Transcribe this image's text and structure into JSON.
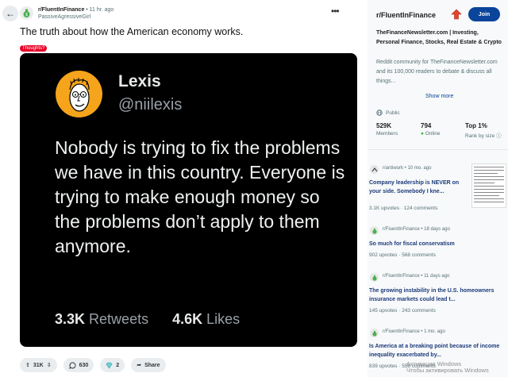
{
  "post": {
    "subreddit": "r/FluentInFinance",
    "time": " • 11 hr. ago",
    "author": "PassiveAgressiveGirl",
    "title": "The truth about how the American economy works.",
    "flair": "Thoughts?",
    "more_icon": "ellipsis-icon"
  },
  "tweet": {
    "name": "Lexis",
    "handle": "@niilexis",
    "text": "Nobody is trying to fix the problems we have in this country. Everyone is trying to make enough money so the problems don’t apply to them anymore.",
    "retweets_count": "3.3K",
    "retweets_label": "Retweets",
    "likes_count": "4.6K",
    "likes_label": "Likes"
  },
  "actions": {
    "votes": "31K",
    "comments": "630",
    "awards": "2",
    "share": "Share"
  },
  "sidebar": {
    "name": "r/FluentInFinance",
    "join": "Join",
    "headline": "TheFinanceNewsletter.com | Investing, Personal Finance, Stocks, Real Estate & Crypto",
    "description": "Reddit community for TheFinanceNewsletter.com and its 100,000 readers to debate & discuss all things...",
    "show_more": "Show more",
    "visibility": "Public",
    "stats": [
      {
        "value": "529K",
        "label": "Members"
      },
      {
        "value": "794",
        "label": "Online"
      },
      {
        "value": "Top 1%",
        "label": "Rank by size"
      }
    ]
  },
  "related": [
    {
      "source": "r/antiwork • 10 mo. ago",
      "title": "Company leadership is NEVER on your side. Somebody I kne...",
      "upvotes": "3.1K upvotes",
      "comments": "124 comments"
    },
    {
      "source": "r/FluentInFinance • 18 days ago",
      "title": "So much for fiscal conservatism",
      "upvotes": "902 upvotes",
      "comments": "568 comments"
    },
    {
      "source": "r/FluentInFinance • 11 days ago",
      "title": "The growing instability in the U.S. homeowners insurance markets could lead t...",
      "upvotes": "145 upvotes",
      "comments": "243 comments"
    },
    {
      "source": "r/FluentInFinance • 1 mo. ago",
      "title": "Is America at a breaking point because of income inequality exacerbated by...",
      "upvotes": "839 upvotes",
      "comments": "558 comments"
    }
  ],
  "watermark": {
    "line1": "Активация Windows",
    "line2": "Чтобы активировать Windows"
  },
  "colors": {
    "join": "#0a449b",
    "flair": "#ea0027",
    "card": "#000000",
    "avatar": "#f5a41b"
  }
}
